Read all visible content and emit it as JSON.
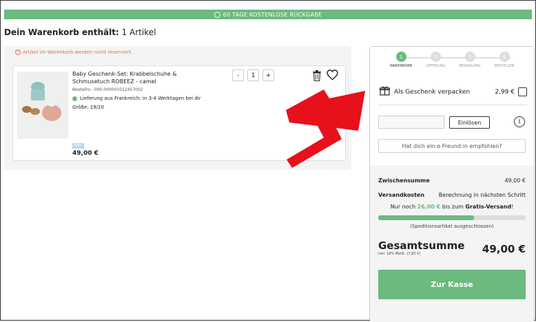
{
  "banner": {
    "text": "60 TAGE KOSTENLOSE RÜCKGABE"
  },
  "header": {
    "title_bold": "Dein Warenkorb enthält:",
    "title_rest": " 1 Artikel"
  },
  "cart": {
    "warning": "Artikel im Warenkorb werden nicht reserviert.",
    "item": {
      "name": "Baby Geschenk-Set: Krabbelschuhe & Schmusetuch ROBEEZ - camel",
      "order_no": "Bestellnr.: 000.000001012457002",
      "delivery": "Lieferung aus Frankreich: in 3-4 Werktagen bei dir",
      "size": "Größe: 19/20",
      "badge": "NEU",
      "price": "49,00 €",
      "quantity": "1",
      "minus": "-",
      "plus": "+"
    }
  },
  "checkout_steps": [
    {
      "num": "1",
      "label": "WARENKORB"
    },
    {
      "num": "2",
      "label": "LIEFERUNG"
    },
    {
      "num": "3",
      "label": "BEZAHLUNG"
    },
    {
      "num": "4",
      "label": "BESTELLEN"
    }
  ],
  "summary": {
    "gift_label": "Als Geschenk verpacken",
    "gift_price": "2,99 €",
    "voucher_placeholder": "",
    "redeem_label": "Einlösen",
    "info_label": "i",
    "friend_label": "Hat dich ein:e Freund:in empfohlen?",
    "subtotal_label": "Zwischensumme",
    "subtotal_value": "49,00 €",
    "shipping_label": "Versandkosten",
    "shipping_value": "Berechnung in nächsten Schritt",
    "free_prefix": "Nur noch ",
    "free_amount": "26,00 €",
    "free_middle": " bis zum ",
    "free_suffix": "Gratis-Versand",
    "free_end": "!",
    "free_progress": 0.65,
    "spedition_note": "(Speditionsartikel ausgeschlossen)",
    "total_label": "Gesamtsumme",
    "total_value": "49,00 €",
    "tax_note": "inkl. 19% MwSt. (7,82 €)",
    "checkout_label": "Zur Kasse"
  },
  "colors": {
    "accent": "#6cba7e",
    "arrow": "#e8101a"
  }
}
